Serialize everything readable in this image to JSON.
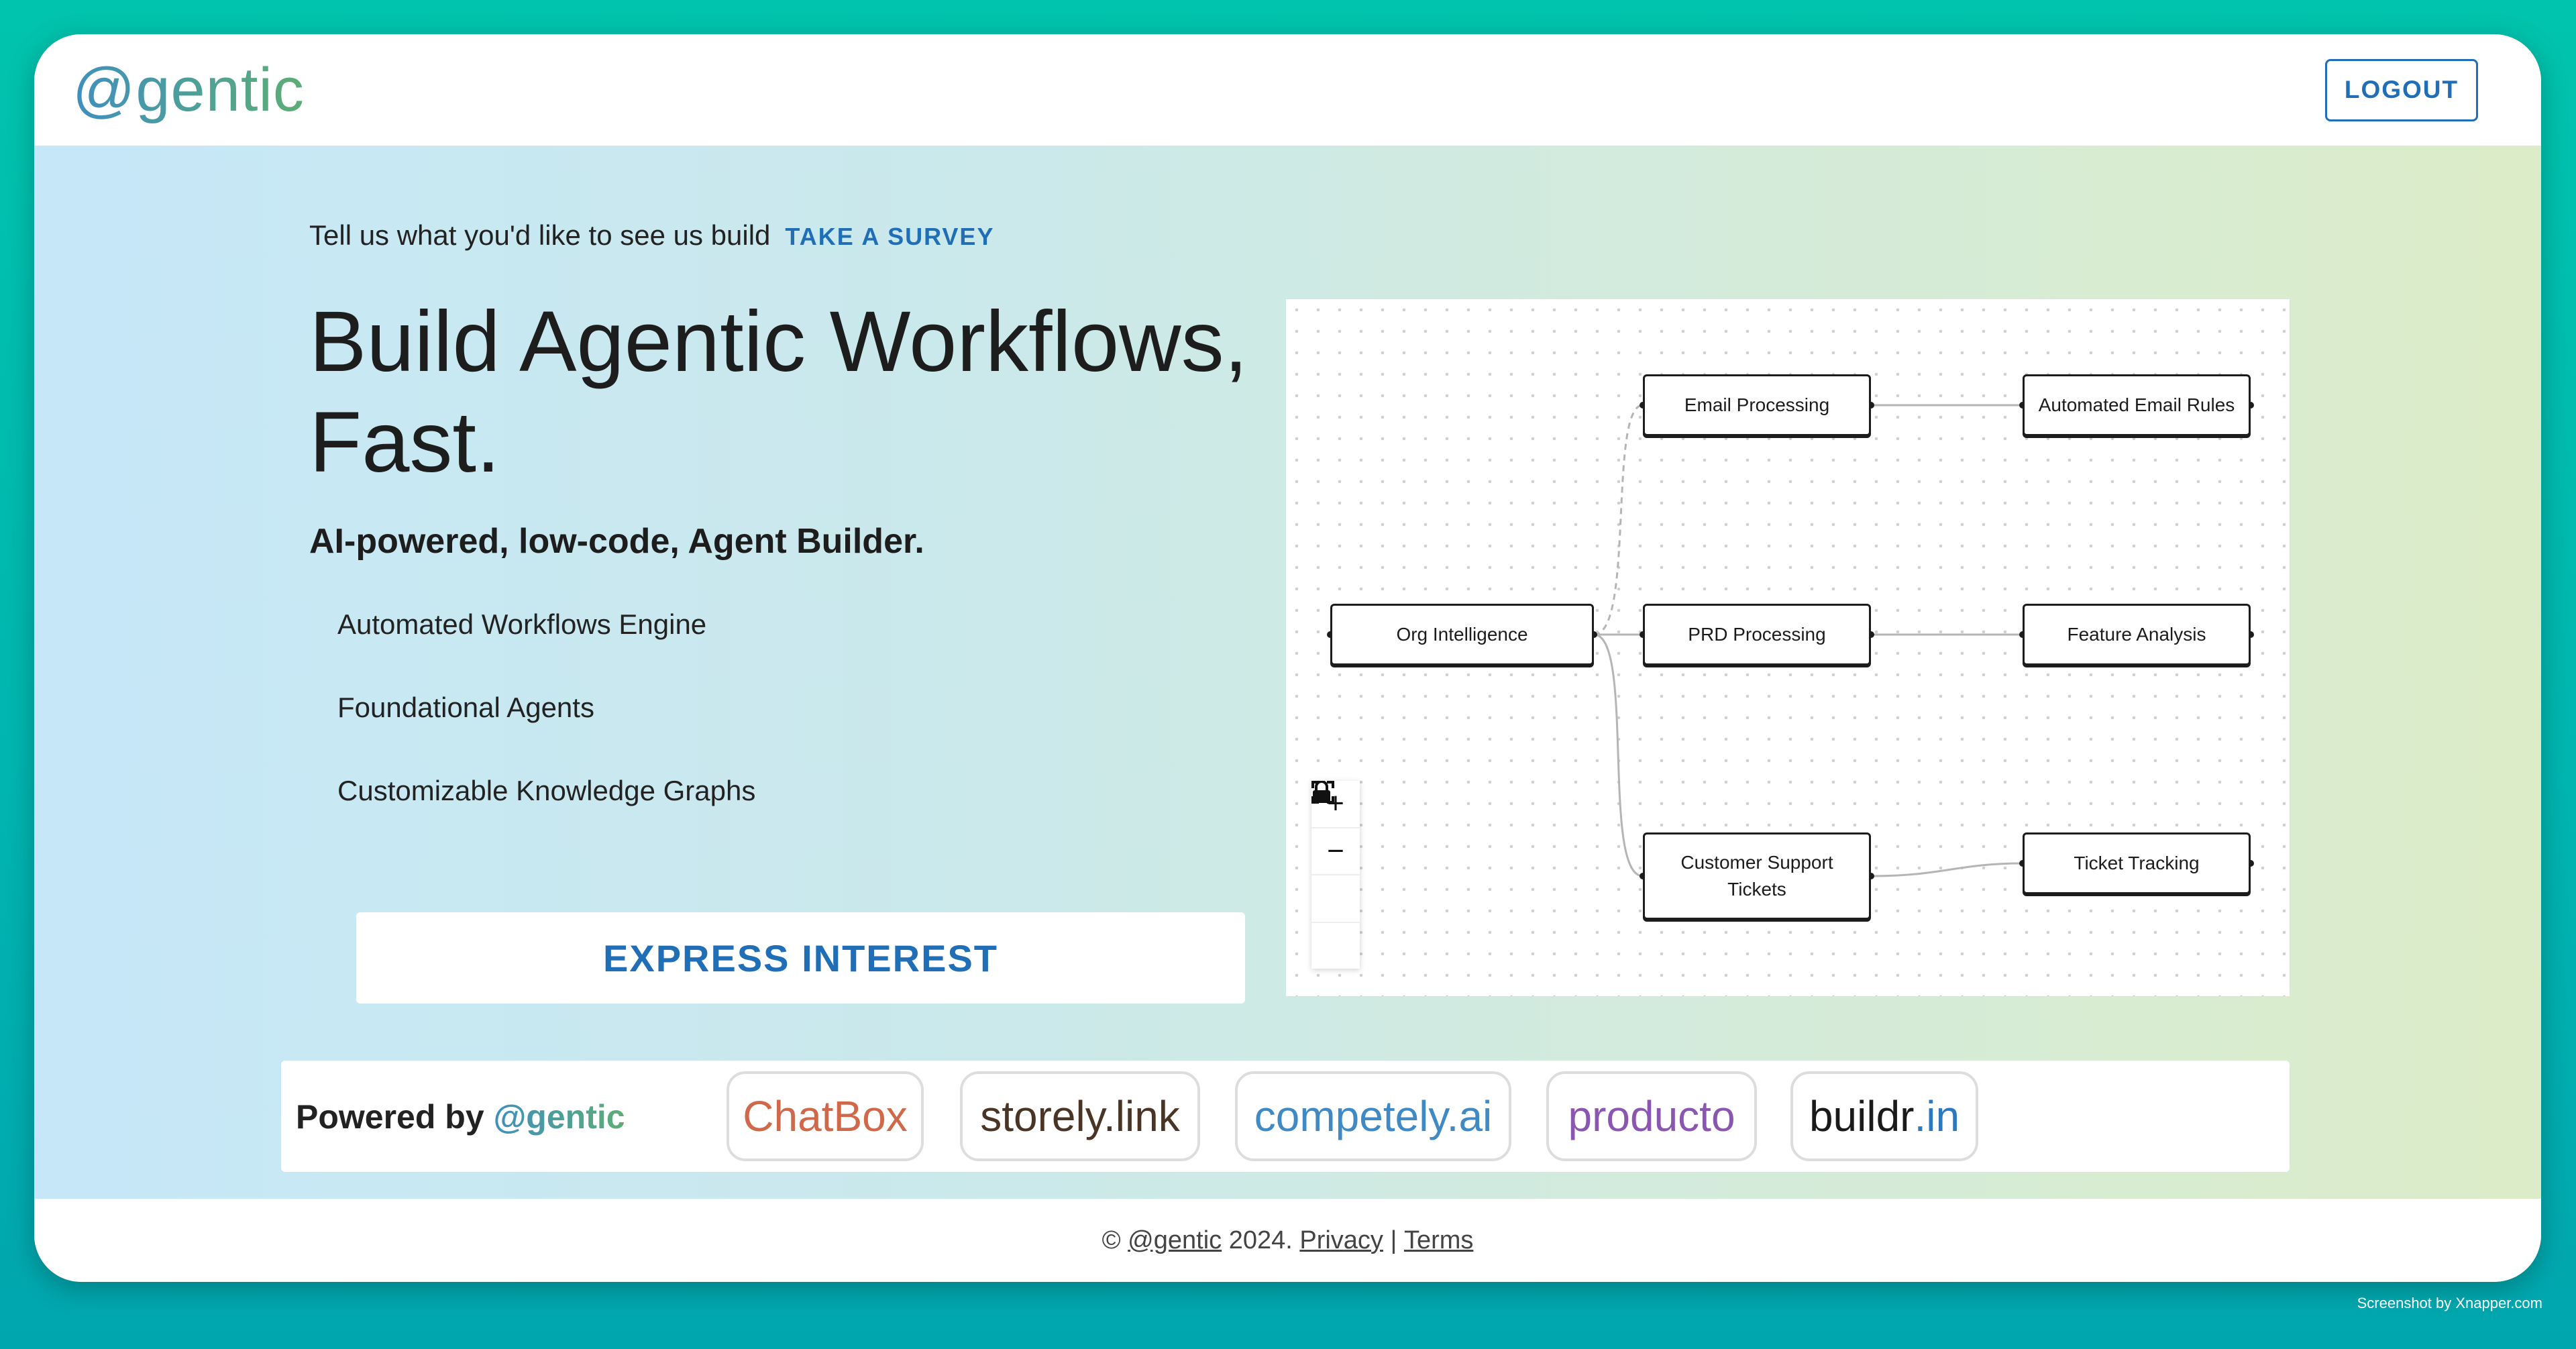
{
  "header": {
    "logo": "@gentic",
    "logout_label": "LOGOUT"
  },
  "hero": {
    "survey_text": "Tell us what you'd like to see us build",
    "survey_link": "TAKE A SURVEY",
    "title_line1": "Build Agentic Workflows,",
    "title_line2": "Fast.",
    "subtitle": "AI-powered, low-code, Agent Builder.",
    "features": [
      "Automated Workflows Engine",
      "Foundational Agents",
      "Customizable Knowledge Graphs"
    ],
    "cta_label": "EXPRESS INTEREST"
  },
  "flow": {
    "nodes": {
      "org": "Org Intelligence",
      "email": "Email Processing",
      "email_rules": "Automated Email Rules",
      "prd": "PRD Processing",
      "feature": "Feature Analysis",
      "support_line1": "Customer Support",
      "support_line2": "Tickets",
      "ticket": "Ticket Tracking"
    },
    "controls": {
      "zoom_in": "+",
      "zoom_out": "−",
      "fit": "⛶",
      "lock": "🔒"
    }
  },
  "powered": {
    "label": "Powered by",
    "brand": "@gentic",
    "chips": [
      {
        "name": "ChatBox",
        "color": "#d0684a"
      },
      {
        "name": "storely.link",
        "color": "#4a3424"
      },
      {
        "name": "competely.ai",
        "color": "#3f89c4"
      },
      {
        "name": "producto",
        "color": "#8a56b0"
      },
      {
        "name": "buildr",
        "suffix": ".in",
        "color": "#1a1a1a",
        "suffix_color": "#2e78c0"
      }
    ]
  },
  "footer": {
    "copyright_prefix": "©",
    "brand": "@gentic",
    "year": "2024.",
    "privacy": "Privacy",
    "separator": "|",
    "terms": "Terms"
  },
  "watermark": "Screenshot by Xnapper.com"
}
